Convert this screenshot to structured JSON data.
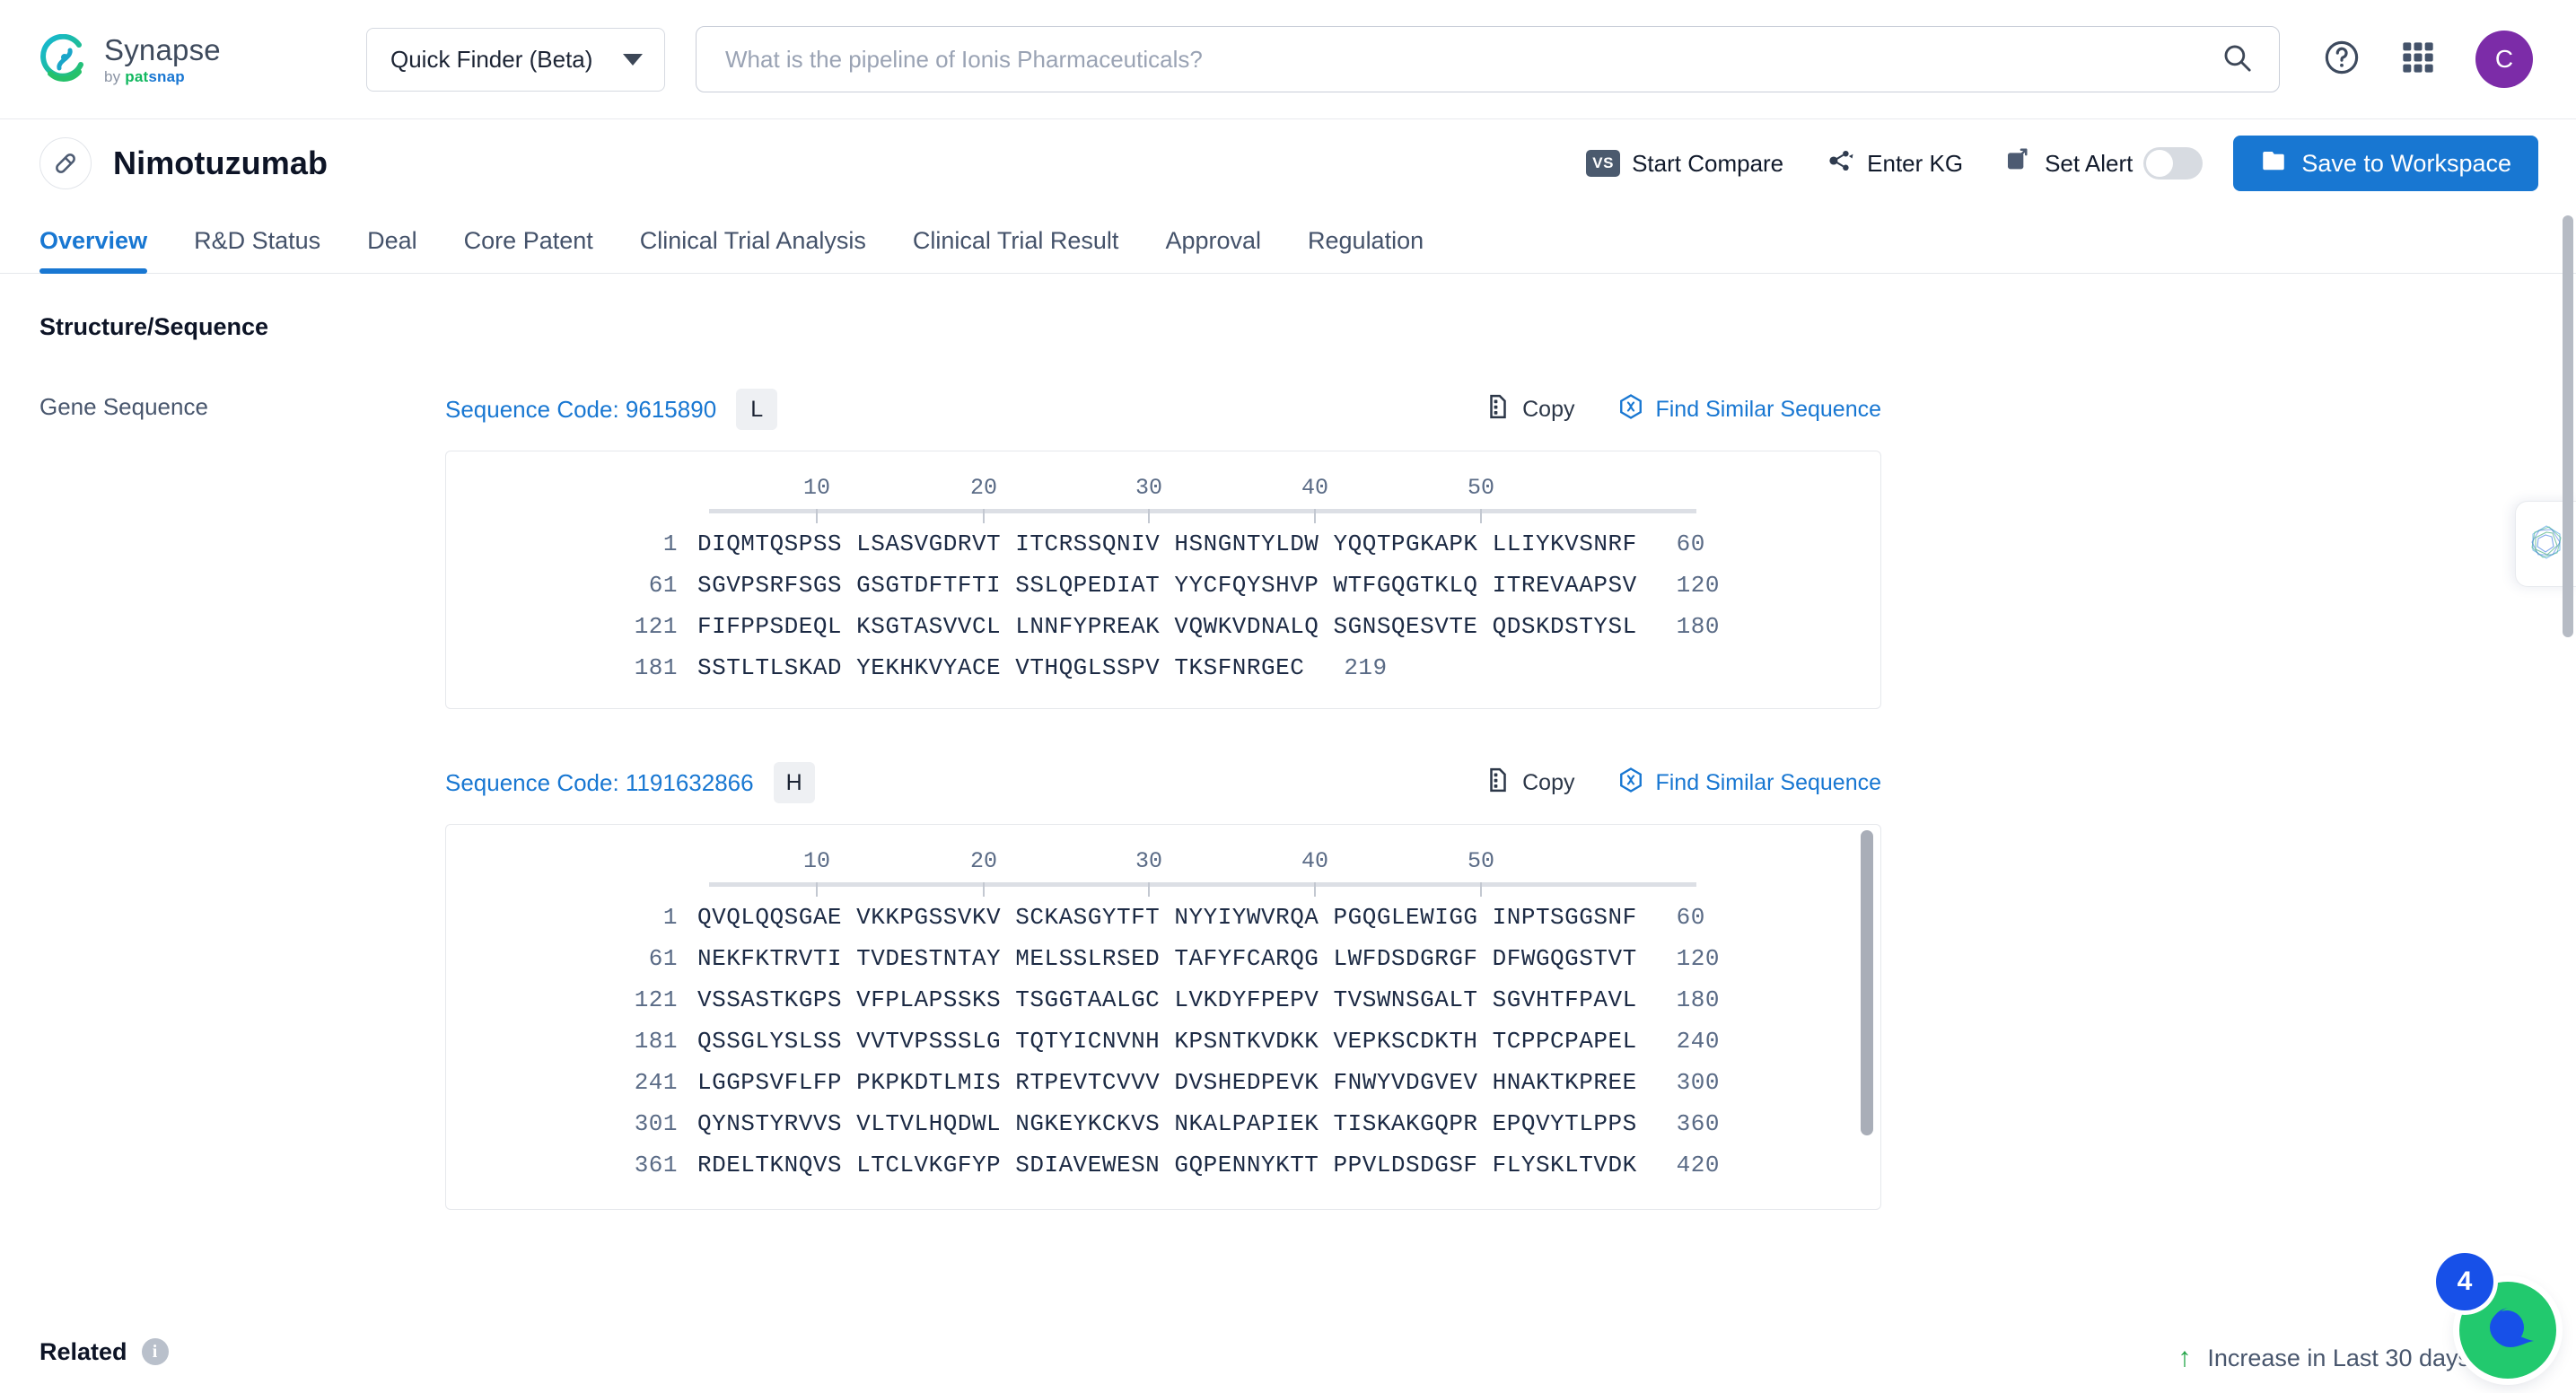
{
  "brand": {
    "name": "Synapse",
    "by": "by ",
    "pat": "pat",
    "snap": "snap"
  },
  "header": {
    "finder_label": "Quick Finder (Beta)",
    "search_placeholder": "What is the pipeline of Ionis Pharmaceuticals?",
    "search_value": "",
    "avatar_initial": "C"
  },
  "title_row": {
    "drug_name": "Nimotuzumab",
    "start_compare": "Start Compare",
    "vs_label": "VS",
    "enter_kg": "Enter KG",
    "set_alert": "Set Alert",
    "alert_enabled": "off",
    "save_to_workspace": "Save to Workspace"
  },
  "tabs": [
    {
      "label": "Overview",
      "active": true
    },
    {
      "label": "R&D Status",
      "active": false
    },
    {
      "label": "Deal",
      "active": false
    },
    {
      "label": "Core Patent",
      "active": false
    },
    {
      "label": "Clinical Trial Analysis",
      "active": false
    },
    {
      "label": "Clinical Trial Result",
      "active": false
    },
    {
      "label": "Approval",
      "active": false
    },
    {
      "label": "Regulation",
      "active": false
    }
  ],
  "main": {
    "section_title": "Structure/Sequence",
    "row_label": "Gene Sequence",
    "copy_label": "Copy",
    "find_similar_label": "Find Similar Sequence",
    "ruler_ticks": [
      10,
      20,
      30,
      40,
      50
    ],
    "sequences": [
      {
        "code_label": "Sequence Code: 9615890",
        "chain": "L",
        "lines": [
          {
            "start": "1",
            "residues": "DIQMTQSPSS LSASVGDRVT ITCRSSQNIV HSNGNTYLDW YQQTPGKAPK LLIYKVSNRF",
            "end": "60"
          },
          {
            "start": "61",
            "residues": "SGVPSRFSGS GSGTDFTFTI SSLQPEDIAT YYCFQYSHVP WTFGQGTKLQ ITREVAAPSV",
            "end": "120"
          },
          {
            "start": "121",
            "residues": "FIFPPSDEQL KSGTASVVCL LNNFYPREAK VQWKVDNALQ SGNSQESVTE QDSKDSTYSL",
            "end": "180"
          },
          {
            "start": "181",
            "residues": "SSTLTLSKAD YEKHKVYACE VTHQGLSSPV TKSFNRGEC",
            "end": "219"
          }
        ]
      },
      {
        "code_label": "Sequence Code: 1191632866",
        "chain": "H",
        "lines": [
          {
            "start": "1",
            "residues": "QVQLQQSGAE VKKPGSSVKV SCKASGYTFT NYYIYWVRQA PGQGLEWIGG INPTSGGSNF",
            "end": "60"
          },
          {
            "start": "61",
            "residues": "NEKFKTRVTI TVDESTNTAY MELSSLRSED TAFYFCARQG LWFDSDGRGF DFWGQGSTVT",
            "end": "120"
          },
          {
            "start": "121",
            "residues": "VSSASTKGPS VFPLAPSSKS TSGGTAALGC LVKDYFPEPV TVSWNSGALT SGVHTFPAVL",
            "end": "180"
          },
          {
            "start": "181",
            "residues": "QSSGLYSLSS VVTVPSSSLG TQTYICNVNH KPSNTKVDKK VEPKSCDKTH TCPPCPAPEL",
            "end": "240"
          },
          {
            "start": "241",
            "residues": "LGGPSVFLFP PKPKDTLMIS RTPEVTCVVV DVSHEDPEVK FNWYVDGVEV HNAKTKPREE",
            "end": "300"
          },
          {
            "start": "301",
            "residues": "QYNSTYRVVS VLTVLHQDWL NGKEYKCKVS NKALPAPIEK TISKAKGQPR EPQVYTLPPS",
            "end": "360"
          },
          {
            "start": "361",
            "residues": "RDELTKNQVS LTCLVKGFYP SDIAVEWESN GQPENNYKTT PPVLDSDGSF FLYSKLTVDK",
            "end": "420"
          }
        ]
      }
    ]
  },
  "bottom": {
    "related_label": "Related",
    "increase_label": "Increase in Last 30 days",
    "chat_badge_count": "4"
  },
  "colors": {
    "accent_blue": "#1877d2",
    "avatar_purple": "#7c2ca8",
    "green": "#22c96e",
    "badge_blue": "#1750e8",
    "up_green": "#22a447"
  }
}
